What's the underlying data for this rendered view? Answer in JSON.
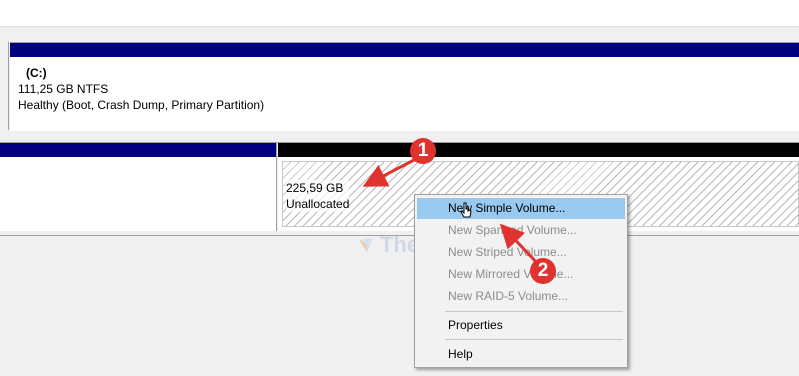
{
  "disk0": {
    "partition": {
      "name": "(C:)",
      "size_fs": "111,25 GB NTFS",
      "status": "Healthy (Boot, Crash Dump, Primary Partition)"
    }
  },
  "disk1": {
    "unallocated": {
      "size": "225,59 GB",
      "label": "Unallocated"
    }
  },
  "context_menu": {
    "items": [
      {
        "label": "New Simple Volume...",
        "enabled": true,
        "highlighted": true
      },
      {
        "label": "New Spanned Volume...",
        "enabled": false
      },
      {
        "label": "New Striped Volume...",
        "enabled": false
      },
      {
        "label": "New Mirrored Volume...",
        "enabled": false
      },
      {
        "label": "New RAID-5 Volume...",
        "enabled": false
      },
      {
        "label": "Properties",
        "enabled": true
      },
      {
        "label": "Help",
        "enabled": true
      }
    ]
  },
  "watermark": {
    "text": "TheLast"
  },
  "annotations": {
    "step1": "1",
    "step2": "2",
    "color": "#e0322f"
  },
  "colors": {
    "primary_partition_band": "#00007f",
    "unallocated_band": "#000000",
    "menu_highlight": "#99c9ef"
  }
}
